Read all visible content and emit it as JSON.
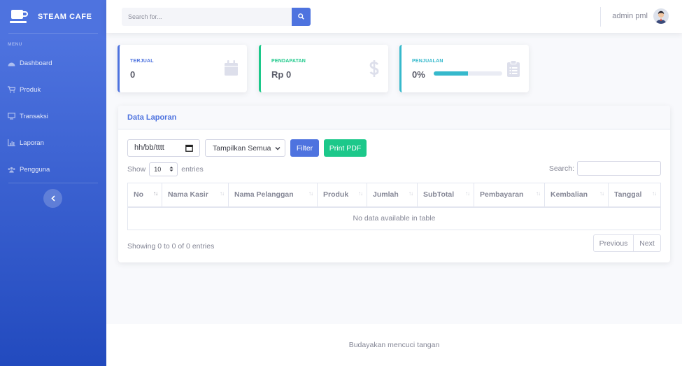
{
  "brand": {
    "name": "STEAM CAFE",
    "icon": "coffee-cup-icon"
  },
  "sidebar": {
    "heading": "MENU",
    "items": [
      {
        "label": "Dashboard",
        "icon": "tachometer-icon"
      },
      {
        "label": "Produk",
        "icon": "cart-icon"
      },
      {
        "label": "Transaksi",
        "icon": "desktop-icon"
      },
      {
        "label": "Laporan",
        "icon": "chart-icon"
      },
      {
        "label": "Pengguna",
        "icon": "users-icon"
      }
    ],
    "toggle_icon": "chevron-left-icon"
  },
  "topbar": {
    "search_placeholder": "Search for...",
    "user_name": "admin pml"
  },
  "stats": [
    {
      "label": "TERJUAL",
      "value": "0",
      "color": "#4e73df",
      "icon": "calendar-icon"
    },
    {
      "label": "PENDAPATAN",
      "value": "Rp 0",
      "color": "#1cc88a",
      "icon": "dollar-icon"
    },
    {
      "label": "PENJUALAN",
      "value": "0%",
      "color": "#36b9cc",
      "icon": "clipboard-icon",
      "progress_percent": 50
    }
  ],
  "report": {
    "title": "Data Laporan",
    "date_placeholder": "hh/bb/tttt",
    "filter_select": "Tampilkan Semua",
    "filter_button": "Filter",
    "pdf_button": "Print PDF",
    "show_label": "Show",
    "entries_value": "10",
    "entries_label": "entries",
    "search_label": "Search:",
    "columns": [
      "No",
      "Nama Kasir",
      "Nama Pelanggan",
      "Produk",
      "Jumlah",
      "SubTotal",
      "Pembayaran",
      "Kembalian",
      "Tanggal"
    ],
    "empty_message": "No data available in table",
    "info": "Showing 0 to 0 of 0 entries",
    "prev_label": "Previous",
    "next_label": "Next"
  },
  "footer": {
    "text": "Budayakan mencuci tangan"
  },
  "colors": {
    "primary": "#4e73df",
    "success": "#1cc88a",
    "info": "#36b9cc"
  }
}
